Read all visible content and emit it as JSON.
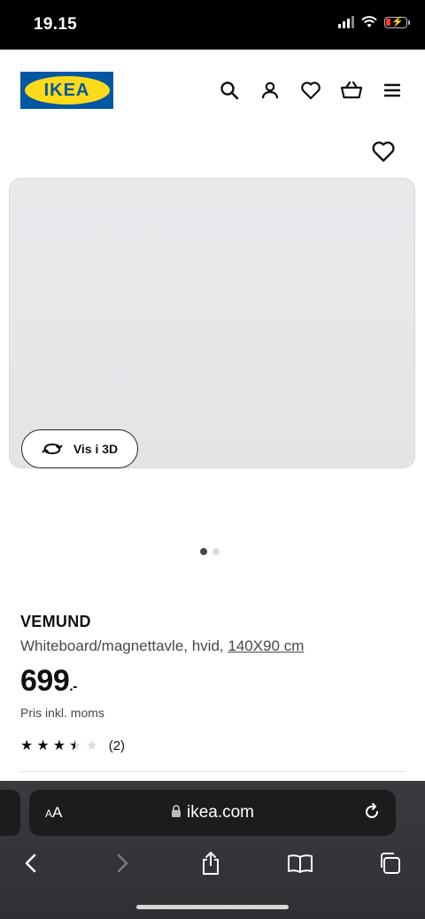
{
  "status_bar": {
    "time": "19.15"
  },
  "header": {
    "logo_text": "IKEA",
    "icons": [
      "search-icon",
      "profile-icon",
      "heart-icon",
      "basket-icon",
      "menu-icon"
    ]
  },
  "product": {
    "btn_3d_label": "Vis i 3D",
    "image_count": 2,
    "active_image": 1,
    "name": "VEMUND",
    "description": "Whiteboard/magnettavle, hvid, ",
    "size": "140X90 cm",
    "price": "699",
    "price_suffix": ".-",
    "price_note": "Pris inkl. moms",
    "rating": 3.5,
    "rating_max": 5,
    "review_count": "(2)"
  },
  "browser": {
    "aa_label": "AA",
    "url": "ikea.com",
    "nav_icons": [
      "back-icon",
      "forward-icon",
      "share-icon",
      "bookmarks-icon",
      "tabs-icon"
    ]
  },
  "colors": {
    "brand_blue": "#0058a3",
    "brand_yellow": "#ffda1a"
  }
}
